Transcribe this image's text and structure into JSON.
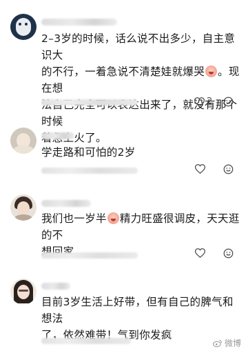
{
  "comments": [
    {
      "text_lines": [
        "2–3岁的时候，话么说不出多少，自主意识大",
        "的不行，一着急说不清楚娃就爆哭",
        "。现在想",
        "法自己完全可以表达出来了，就没有那个时候",
        "着急上火了。"
      ],
      "likes": "2"
    },
    {
      "text_lines": [
        "学走路和可怕的2岁"
      ],
      "likes": ""
    },
    {
      "text_lines": [
        "我们也一岁半",
        "精力旺盛很调皮，天天逛的不",
        "想回家"
      ],
      "likes": ""
    },
    {
      "text_lines": [
        "目前3岁生活上好带，但有自己的脾气和想法",
        "了，依然难带！气到你发疯"
      ],
      "likes": ""
    }
  ],
  "icons": {
    "like": "heart-outline-icon",
    "more": "reply-emoji-icon",
    "emoji": "crying-face-emoji"
  },
  "watermark": "微博"
}
